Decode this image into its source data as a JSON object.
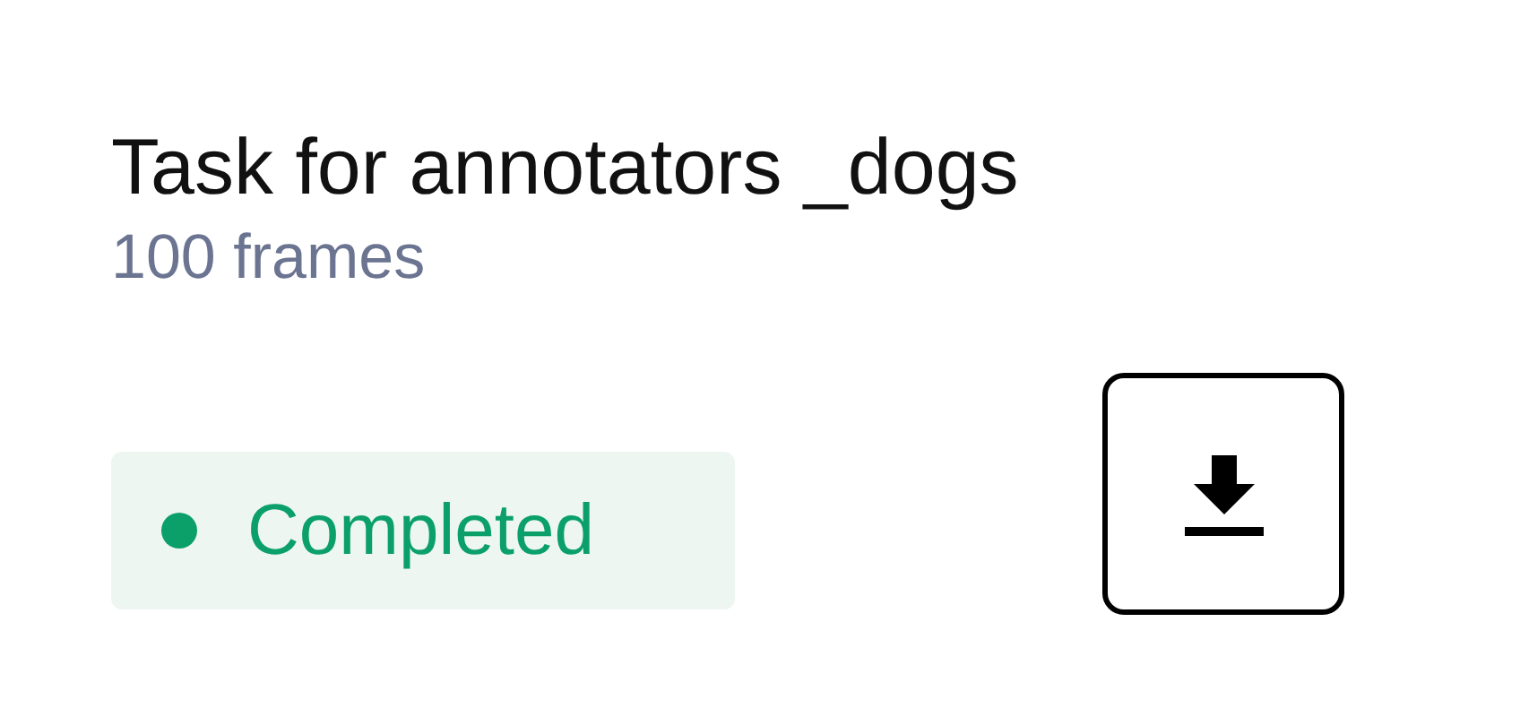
{
  "task": {
    "title": "Task for annotators _dogs",
    "frames": "100 frames"
  },
  "status": {
    "label": "Completed",
    "color": "#0ba06a"
  }
}
